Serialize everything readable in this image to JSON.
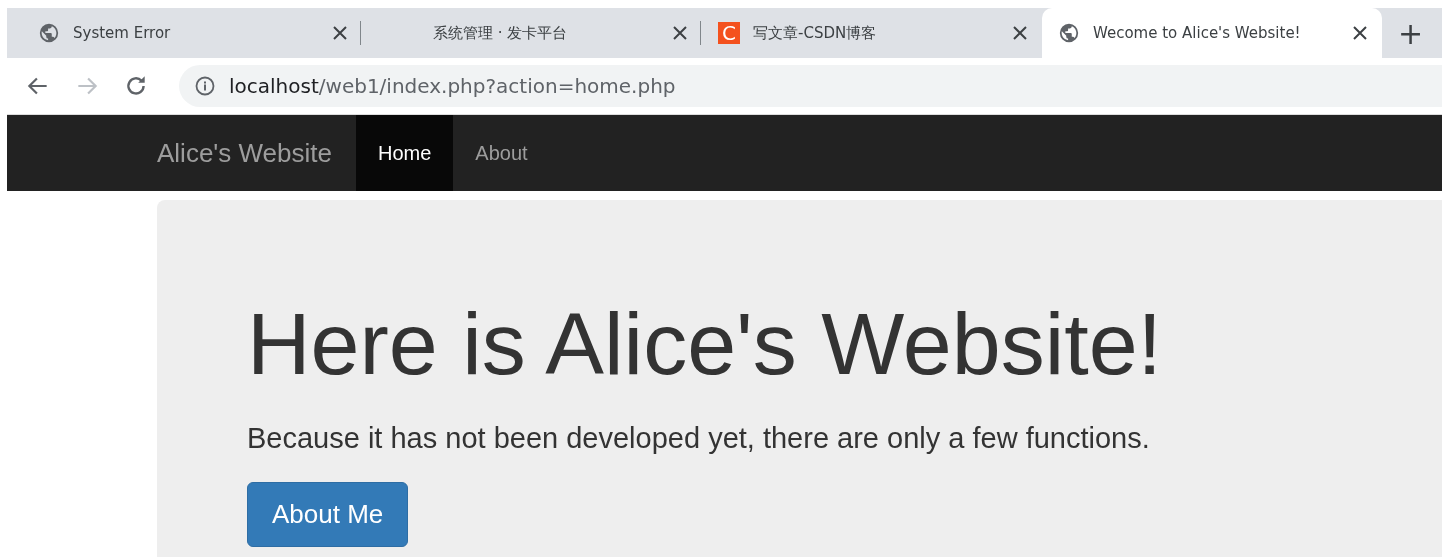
{
  "browser": {
    "tabs": [
      {
        "title": "System Error",
        "kind": "globe",
        "selected": false
      },
      {
        "title": "系统管理 · 发卡平台",
        "kind": "blank",
        "selected": false
      },
      {
        "title": "写文章-CSDN博客",
        "kind": "letter",
        "icon_text": "C",
        "selected": false
      },
      {
        "title": "Wecome to Alice's Website!",
        "kind": "globe",
        "selected": true
      }
    ],
    "new_tab": "+",
    "address": {
      "host": "localhost",
      "path": "/web1/index.php?action=home.php"
    }
  },
  "navbar": {
    "brand": "Alice's Website",
    "links": [
      {
        "label": "Home",
        "selected": true
      },
      {
        "label": "About",
        "selected": false
      }
    ]
  },
  "jumbotron": {
    "heading": "Here is Alice's Website!",
    "text": "Because it has not been developed yet, there are only a few functions.",
    "button": "About Me"
  }
}
